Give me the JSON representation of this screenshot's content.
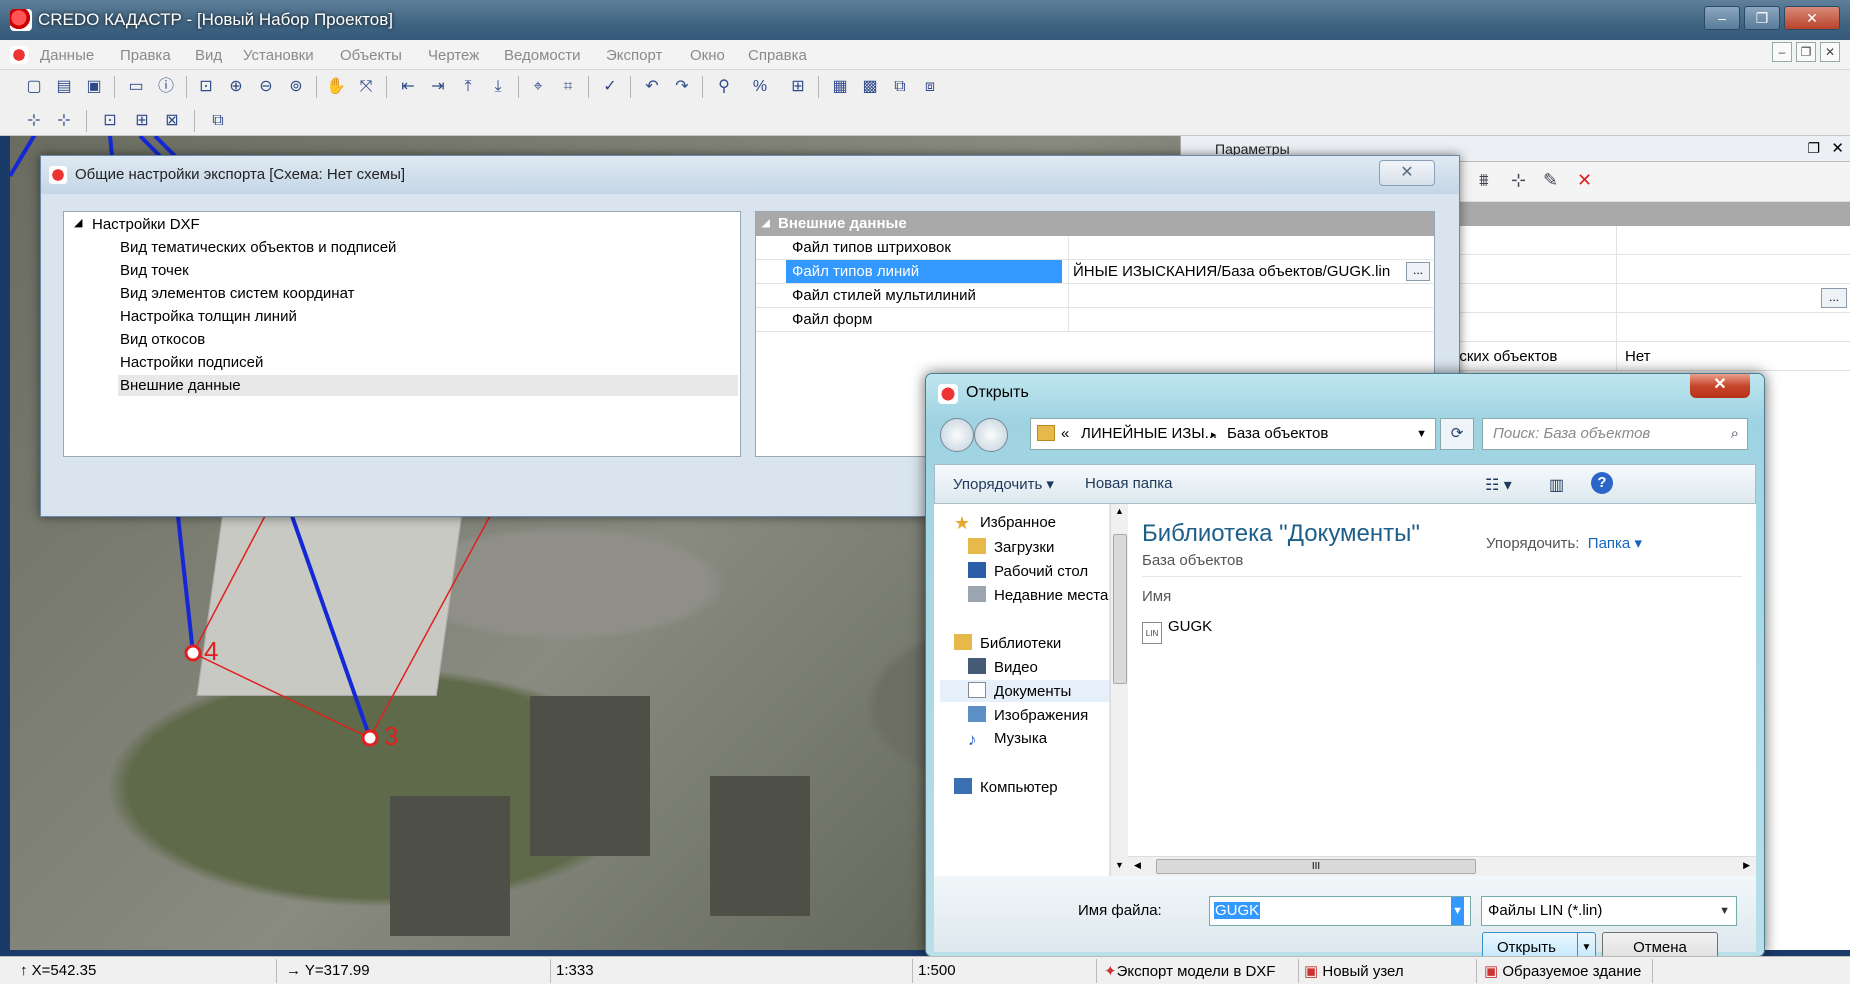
{
  "window": {
    "title": "CREDO КАДАСТР - [Новый Набор Проектов]",
    "controls": {
      "minimize": "–",
      "restore": "❐",
      "close": "✕"
    }
  },
  "menu": [
    "Данные",
    "Правка",
    "Вид",
    "Установки",
    "Объекты",
    "Чертеж",
    "Ведомости",
    "Экспорт",
    "Окно",
    "Справка"
  ],
  "params_panel": {
    "title": "Параметры",
    "rows": [
      {
        "label": "еских объектов",
        "value": "Нет"
      }
    ],
    "icons": [
      "stack-icon",
      "ruler-icon",
      "pen-icon",
      "delete-icon"
    ]
  },
  "map": {
    "points": [
      "4",
      "3"
    ]
  },
  "export_dialog": {
    "title": "Общие настройки экспорта [Схема: Нет схемы]",
    "close": "✕",
    "tree_root": "Настройки DXF",
    "tree_items": [
      "Вид тематических объектов и подписей",
      "Вид точек",
      "Вид элементов систем координат",
      "Настройка толщин линий",
      "Вид откосов",
      "Настройки подписей",
      "Внешние данные"
    ],
    "group": "Внешние данные",
    "props": [
      {
        "key": "Файл типов штриховок",
        "value": ""
      },
      {
        "key": "Файл типов линий",
        "value": "ЙНЫЕ ИЗЫСКАНИЯ/База объектов/GUGK.lin"
      },
      {
        "key": "Файл стилей мультилиний",
        "value": ""
      },
      {
        "key": "Файл форм",
        "value": ""
      }
    ],
    "ellipsis": "..."
  },
  "open_dialog": {
    "title": "Открыть",
    "close": "✕",
    "address": {
      "prefix": "«",
      "part1": "ЛИНЕЙНЫЕ ИЗЫ...",
      "sep": "▸",
      "part2": "База объектов"
    },
    "search_placeholder": "Поиск: База объектов",
    "organize": "Упорядочить",
    "new_folder": "Новая папка",
    "nav": [
      {
        "label": "Избранное",
        "icon": "star-icon",
        "indent": 0
      },
      {
        "label": "Загрузки",
        "icon": "downloads-icon",
        "indent": 1
      },
      {
        "label": "Рабочий стол",
        "icon": "desktop-icon",
        "indent": 1
      },
      {
        "label": "Недавние места",
        "icon": "recent-icon",
        "indent": 1
      },
      {
        "label": "Библиотеки",
        "icon": "library-icon",
        "indent": 0
      },
      {
        "label": "Видео",
        "icon": "video-icon",
        "indent": 1
      },
      {
        "label": "Документы",
        "icon": "documents-icon",
        "indent": 1
      },
      {
        "label": "Изображения",
        "icon": "pictures-icon",
        "indent": 1
      },
      {
        "label": "Музыка",
        "icon": "music-icon",
        "indent": 1
      },
      {
        "label": "Компьютер",
        "icon": "computer-icon",
        "indent": 0
      }
    ],
    "library_title": "Библиотека \"Документы\"",
    "library_sub": "База объектов",
    "arrange_label": "Упорядочить:",
    "arrange_value": "Папка",
    "column": "Имя",
    "files": [
      {
        "name": "GUGK",
        "ext": "LIN"
      }
    ],
    "filename_label": "Имя файла:",
    "filename_value": "GUGK",
    "filetype": "Файлы LIN (*.lin)",
    "open_btn": "Открыть",
    "cancel_btn": "Отмена",
    "scroll_grip": "III"
  },
  "statusbar": {
    "x": "X=542.35",
    "y": "Y=317.99",
    "scale1": "1:333",
    "scale2": "1:500",
    "tasks": [
      "Экспорт модели в DXF",
      "Новый узел",
      "Образуемое здание"
    ]
  },
  "colors": {
    "selection": "#3399ff",
    "line_blue": "#1428d8",
    "line_red": "#e02020"
  }
}
